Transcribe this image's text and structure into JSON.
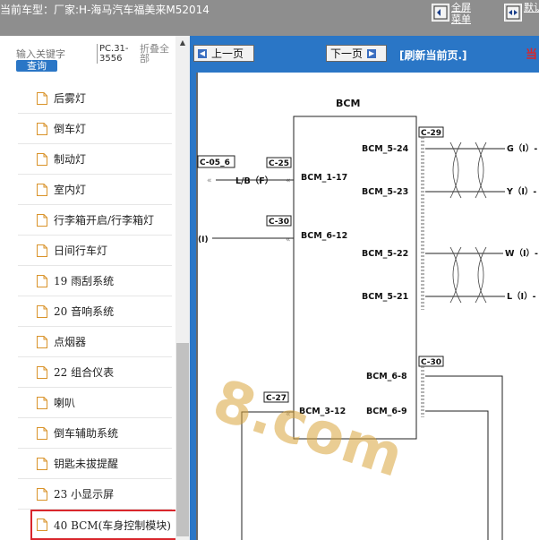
{
  "header": {
    "vehicle_prefix": "当前车型：",
    "vehicle_label": "厂家:H-海马汽车福美来M52014",
    "fullscreen_label": "全屏菜单",
    "default_label": "默认"
  },
  "sidebar": {
    "search_placeholder": "输入关键字",
    "search_button": "查询",
    "pc_code": "PC.31-3556",
    "collapse_all": "折叠全部",
    "items": [
      {
        "label": "后雾灯"
      },
      {
        "label": "倒车灯"
      },
      {
        "label": "制动灯"
      },
      {
        "label": "室内灯"
      },
      {
        "label": "行李箱开启/行李箱灯"
      },
      {
        "label": "日间行车灯"
      },
      {
        "label": "19 雨刮系统"
      },
      {
        "label": "20 音响系统"
      },
      {
        "label": "点烟器"
      },
      {
        "label": "22 组合仪表"
      },
      {
        "label": "喇叭"
      },
      {
        "label": "倒车辅助系统"
      },
      {
        "label": "钥匙未拔提醒"
      },
      {
        "label": "23 小显示屏"
      },
      {
        "label": "40 BCM(车身控制模块)",
        "selected": true
      }
    ]
  },
  "toolbar": {
    "prev_label": "上一页",
    "next_label": "下一页",
    "refresh_label": "[刷新当前页.]",
    "right_mark": "当"
  },
  "diagram": {
    "module_title": "BCM",
    "connectors": {
      "c29": "C-29",
      "c05_6": "C-05_6",
      "c25": "C-25",
      "c30a": "C-30",
      "c30b": "C-30",
      "c27": "C-27"
    },
    "pins": {
      "p5_24": "BCM_5-24",
      "p5_23": "BCM_5-23",
      "p5_22": "BCM_5-22",
      "p5_21": "BCM_5-21",
      "p1_17": "BCM_1-17",
      "p6_12": "BCM_6-12",
      "p6_8": "BCM_6-8",
      "p6_9": "BCM_6-9",
      "p3_12": "BCM_3-12"
    },
    "wires": {
      "lb": "L/B（F）",
      "i_left": "(I)",
      "g": "G（I）-",
      "y": "Y（I）-",
      "w": "W（I）-",
      "l": "L（I）-"
    },
    "watermark": "8.com"
  },
  "colors": {
    "topbar": "#8e8e8e",
    "panel": "#2a76c6",
    "selected_border": "#d9262c"
  }
}
